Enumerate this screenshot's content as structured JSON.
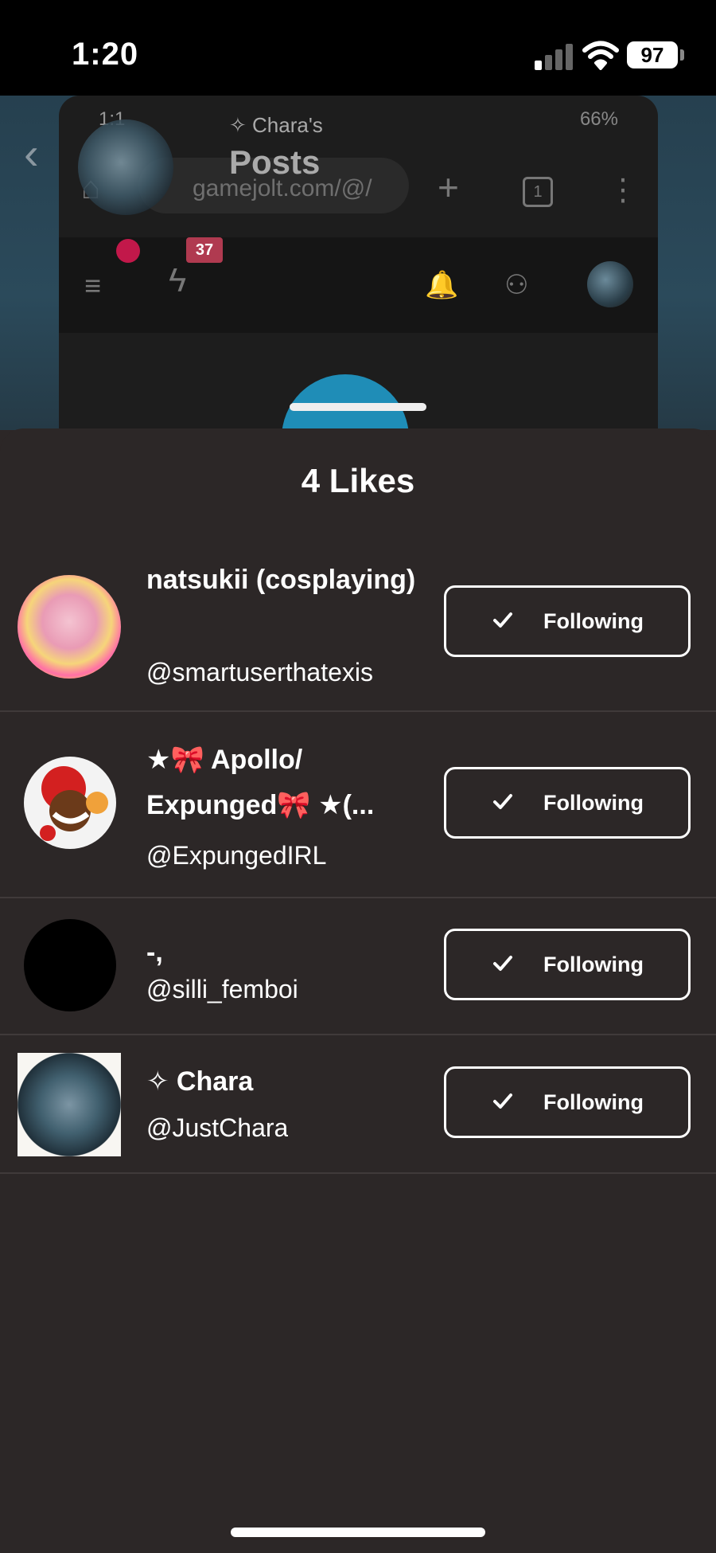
{
  "status_bar": {
    "time": "1:20",
    "battery": "97"
  },
  "background": {
    "phone_status_time": "1:1",
    "phone_status_right": "66%",
    "title_small": "✧ Chara's",
    "title": "Posts",
    "url": "gamejolt.com/@/",
    "tab_count": "1",
    "notification_badge": "37"
  },
  "sheet": {
    "title": "4 Likes",
    "users": [
      {
        "name": "natsukii (cosplaying)",
        "handle": "@smartuserthatexis",
        "button": "Following"
      },
      {
        "name": "★🎀 Apollo/ Expunged🎀 ★(...",
        "handle": "@ExpungedIRL",
        "button": "Following"
      },
      {
        "name": "-,",
        "handle": "@silli_femboi",
        "button": "Following"
      },
      {
        "name": "✧  Chara",
        "handle": "@JustChara",
        "button": "Following"
      }
    ]
  },
  "colors": {
    "sheet_bg": "#2c2727",
    "divider": "#403a3a",
    "text": "#ffffff"
  }
}
